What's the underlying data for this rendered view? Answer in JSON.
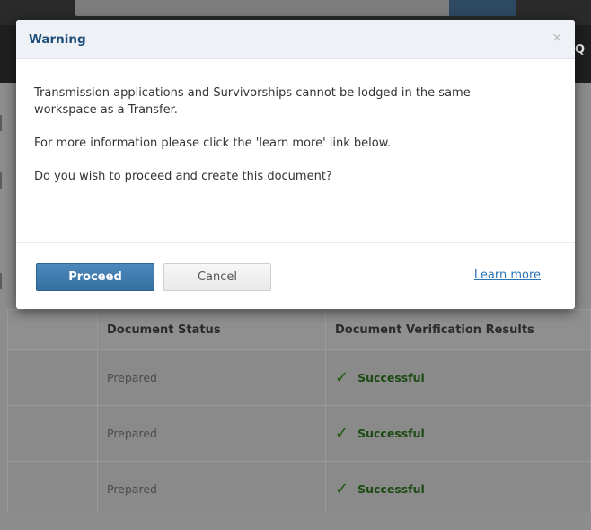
{
  "modal": {
    "title": "Warning",
    "close_glyph": "×",
    "messages": [
      "Transmission applications and Survivorships cannot be lodged in the same workspace as a Transfer.",
      "For more information please click the 'learn more' link below.",
      "Do you wish to proceed and create this document?"
    ],
    "proceed_label": "Proceed",
    "cancel_label": "Cancel",
    "learn_more_label": "Learn more"
  },
  "background": {
    "search_icon_glyph": "Q",
    "table": {
      "headers": [
        "",
        "Document Status",
        "Document Verification Results"
      ],
      "rows": [
        {
          "status": "Prepared",
          "result": "Successful"
        },
        {
          "status": "Prepared",
          "result": "Successful"
        },
        {
          "status": "Prepared",
          "result": "Successful"
        }
      ],
      "check_glyph": "✓"
    }
  },
  "colors": {
    "header_title": "#1f4e79",
    "proceed_button": "#3d7bb0",
    "link": "#2a74b8",
    "success": "#1c5a10"
  }
}
